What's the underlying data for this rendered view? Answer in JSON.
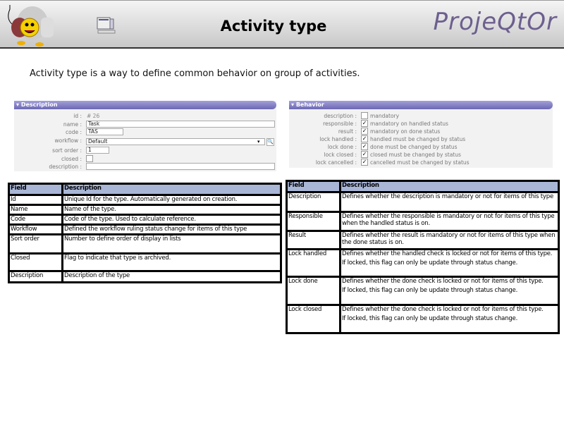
{
  "header": {
    "title": "Activity type",
    "brand": "ProjeQtOr"
  },
  "intro": "Activity type is a way to define common behavior on group of activities.",
  "description_panel": {
    "title": "Description",
    "id_label": "id :",
    "id_value": "# 26",
    "name_label": "name :",
    "name_value": "Task",
    "code_label": "code :",
    "code_value": "TAS",
    "workflow_label": "workflow :",
    "workflow_value": "Default",
    "sort_label": "sort order :",
    "sort_value": "1",
    "closed_label": "closed :",
    "closed_checked": false,
    "description_label": "description :",
    "description_value": ""
  },
  "behavior_panel": {
    "title": "Behavior",
    "items": [
      {
        "label": "description :",
        "checked": false,
        "text": "mandatory"
      },
      {
        "label": "responsible :",
        "checked": true,
        "text": "mandatory on handled status"
      },
      {
        "label": "result :",
        "checked": true,
        "text": "mandatory on done status"
      },
      {
        "label": "lock handled :",
        "checked": true,
        "text": "handled must be changed by status"
      },
      {
        "label": "lock done :",
        "checked": true,
        "text": "done must be changed by status"
      },
      {
        "label": "lock closed :",
        "checked": true,
        "text": "closed must be changed by status"
      },
      {
        "label": "lock cancelled :",
        "checked": true,
        "text": "cancelled must be changed by status"
      }
    ]
  },
  "left_table": {
    "headers": [
      "Field",
      "Description"
    ],
    "rows": [
      [
        "Id",
        "Unique Id for the type. Automatically generated on creation."
      ],
      [
        "Name",
        "Name of the type."
      ],
      [
        "Code",
        "Code of the type. Used to calculate reference."
      ],
      [
        "Workflow",
        "Defined the workflow ruling status change for items of this type"
      ],
      [
        "Sort order",
        "Number to define order of display in lists"
      ],
      [
        "Closed",
        "Flag to indicate that type is archived."
      ],
      [
        "Description",
        "Description of the type"
      ]
    ]
  },
  "right_table": {
    "headers": [
      "Field",
      "Description"
    ],
    "rows": [
      [
        "Description",
        "Defines whether the description is mandatory or not for items of this type",
        ""
      ],
      [
        "Responsible",
        "Defines whether the responsible is mandatory or not for items of this type when the handled status is on.",
        ""
      ],
      [
        "Result",
        "Defines whether the result is mandatory or not for items of this type when the done status is on.",
        ""
      ],
      [
        "Lock handled",
        "Defines whether the handled check is locked or not for items of this type.",
        "If locked, this flag can only be update through status change."
      ],
      [
        "Lock done",
        "Defines whether the done check is locked or not for items of this type.",
        "If locked, this flag can only be update through status change."
      ],
      [
        "Lock closed",
        "Defines whether the done check is locked or not for items of this type.",
        "If locked, this flag can only be update through status change."
      ]
    ]
  }
}
